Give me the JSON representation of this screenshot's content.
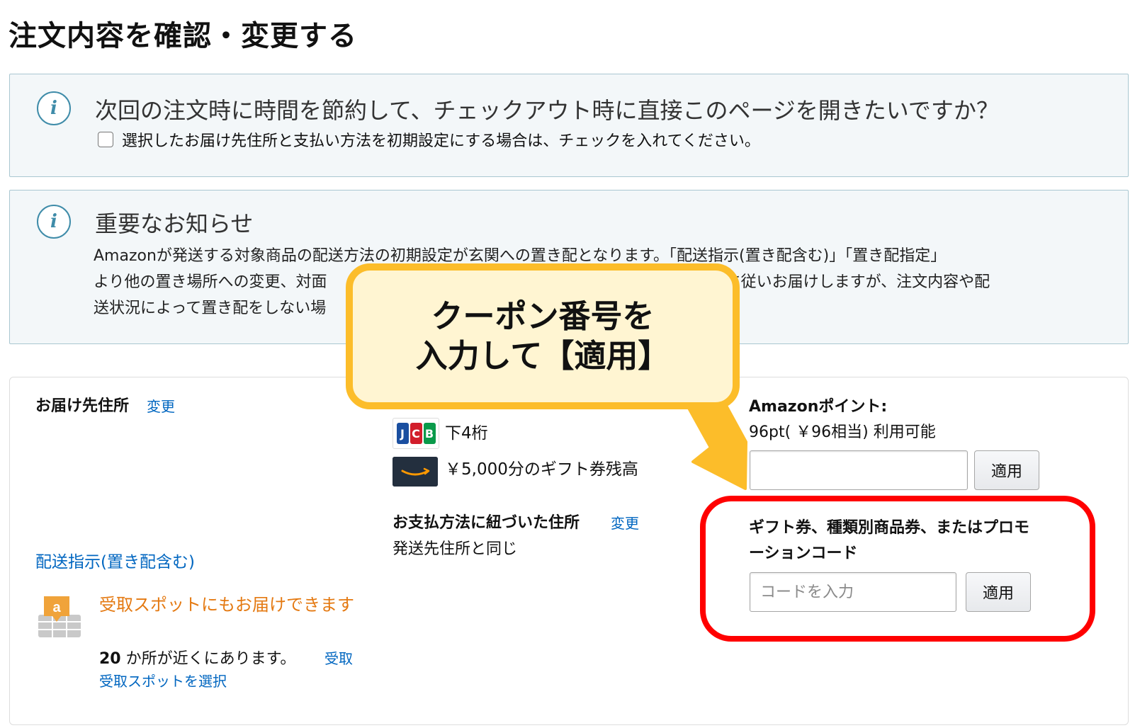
{
  "page": {
    "title": "注文内容を確認・変更する"
  },
  "default_settings_box": {
    "icon": "info-icon",
    "title": "次回の注文時に時間を節約して、チェックアウト時に直接このページを開きたいですか？",
    "checkbox_label": "選択したお届け先住所と支払い方法を初期設定にする場合は、チェックを入れてください。",
    "checked": false
  },
  "notice_box": {
    "icon": "info-icon",
    "title": "重要なお知らせ",
    "line1": "Amazonが発送する対象商品の配送方法の初期設定が玄関への置き配となります。「配送指示(置き配含む)」「置き配指定」",
    "line2_start": "より他の置き場所への変更、対面",
    "line2_end": "示に従いお届けしますが、注文内容や配",
    "line3_start": "送状況によって置き配をしない場"
  },
  "shipping": {
    "label": "お届け先住所",
    "change_link": "変更",
    "delivery_instructions_link": "配送指示(置き配含む)",
    "pickup_icon": "amazon-locker-icon",
    "pickup_title": "受取スポットにもお届けできます",
    "pickup_count": "20",
    "pickup_count_text": " か所が近くにあります。",
    "pickup_select_link": "受取スポットを選択"
  },
  "payment": {
    "card_icon": "jcb-card-icon",
    "card_text": "下4桁",
    "gift_icon": "amazon-gift-card-icon",
    "gift_balance_text": "￥5,000分のギフト券残高",
    "billing_address_label": "お支払方法に紐づいた住所",
    "billing_change_link": "変更",
    "billing_address_value": "発送先住所と同じ"
  },
  "points": {
    "label": "Amazonポイント:",
    "available_text": "96pt( ￥96相当) 利用可能",
    "input_value": "",
    "apply_label": "適用"
  },
  "promo": {
    "label_line1": "ギフト券、種類別商品券、またはプロモ",
    "label_line2": "ーションコード",
    "placeholder": "コードを入力",
    "input_value": "",
    "apply_label": "適用"
  },
  "callout": {
    "line1": "クーポン番号を",
    "line2": "入力して【適用】"
  },
  "colors": {
    "link": "#0066c0",
    "pickup_orange": "#e47911",
    "highlight_red": "#ff0000",
    "callout_border": "#fcbd2a",
    "callout_fill": "#fff5d2",
    "info_border": "#a9c7d1"
  }
}
